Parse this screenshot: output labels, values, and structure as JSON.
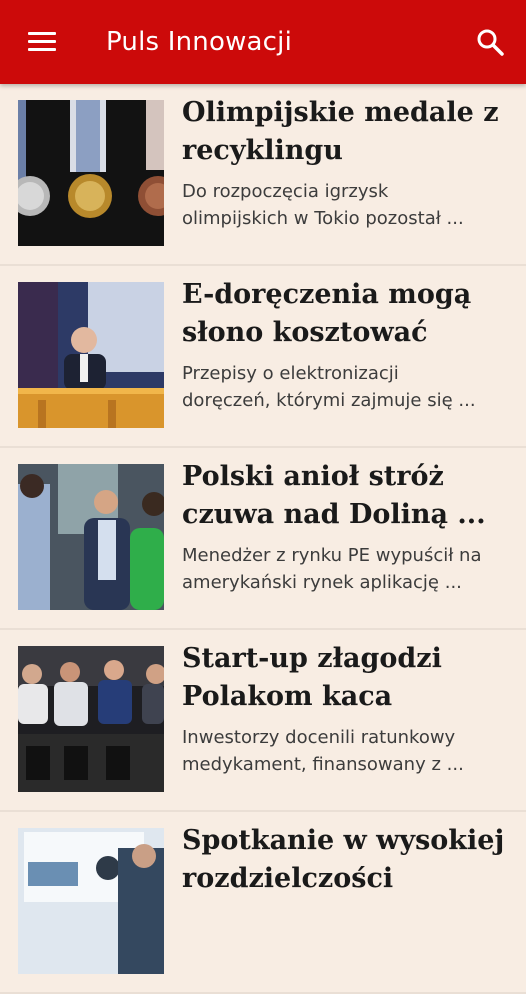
{
  "app_bar": {
    "title": "Puls Innowacji",
    "menu_icon": "hamburger-menu-icon",
    "search_icon": "search-icon",
    "background": "#cc0a0a"
  },
  "articles": [
    {
      "headline_lines": [
        "Olimpijskie medale z",
        "recyklingu"
      ],
      "summary_lines": [
        "Do rozpoczęcia igrzysk",
        "olimpijskich w Tokio pozostał ..."
      ],
      "thumbnail": "olympic-medals-photo"
    },
    {
      "headline_lines": [
        "E-doręczenia mogą",
        "słono kosztować"
      ],
      "summary_lines": [
        "Przepisy o elektronizacji",
        "doręczeń, którymi zajmuje się ..."
      ],
      "thumbnail": "man-at-desk-photo"
    },
    {
      "headline_lines": [
        "Polski anioł stróż",
        "czuwa nad Doliną ..."
      ],
      "summary_lines": [
        "Menedżer z rynku PE wypuścił na",
        "amerykański rynek aplikację ..."
      ],
      "thumbnail": "people-talking-photo"
    },
    {
      "headline_lines": [
        "Start-up złagodzi",
        "Polakom kaca"
      ],
      "summary_lines": [
        "Inwestorzy docenili ratunkowy",
        "medykament, finansowany z ..."
      ],
      "thumbnail": "panel-discussion-photo"
    },
    {
      "headline_lines": [
        "Spotkanie w wysokiej",
        "rozdzielczości"
      ],
      "summary_lines": [
        "",
        ""
      ],
      "thumbnail": "display-screen-photo"
    }
  ]
}
